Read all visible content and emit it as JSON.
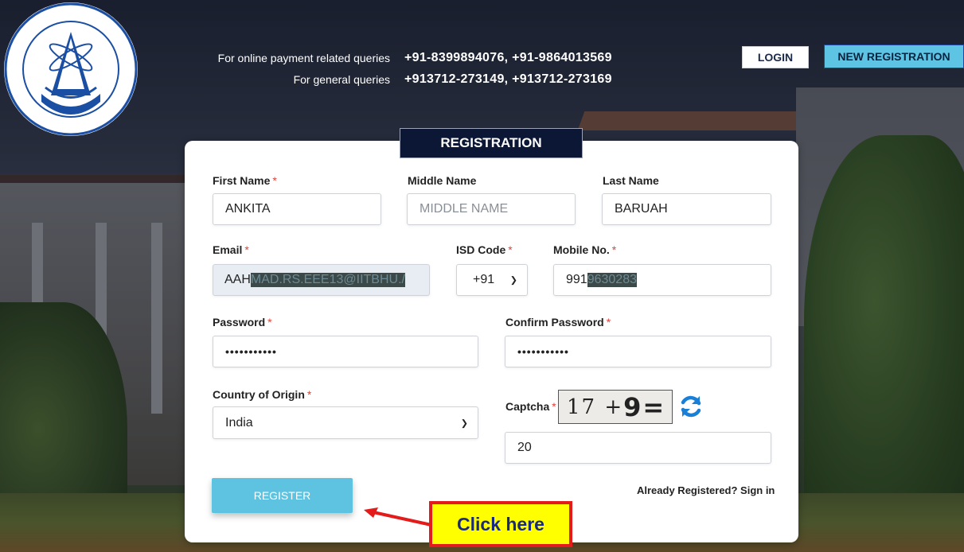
{
  "logo": {
    "alt": "Tezpur University"
  },
  "header": {
    "payment_label": "For online payment related queries",
    "payment_numbers": "+91-8399894076, +91-9864013569",
    "general_label": "For general queries",
    "general_numbers": "+913712-273149, +913712-273169",
    "login_button": "LOGIN",
    "new_registration_button": "NEW REGISTRATION"
  },
  "form": {
    "title": "REGISTRATION",
    "first_name": {
      "label": "First Name",
      "required": "*",
      "value": "ANKITA"
    },
    "middle_name": {
      "label": "Middle Name",
      "placeholder": "MIDDLE NAME"
    },
    "last_name": {
      "label": "Last Name",
      "value": "BARUAH"
    },
    "email": {
      "label": "Email",
      "required": "*",
      "value_visible": "AAH",
      "value_redacted": "MAD.RS.EEE13@IITBHU./"
    },
    "isd_code": {
      "label": "ISD Code",
      "required": "*",
      "value": "+91"
    },
    "mobile": {
      "label": "Mobile No.",
      "required": "*",
      "value_visible": "991",
      "value_redacted": "9630283"
    },
    "password": {
      "label": "Password",
      "required": "*",
      "value": "•••••••••••"
    },
    "confirm_password": {
      "label": "Confirm Password",
      "required": "*",
      "value": "•••••••••••"
    },
    "country": {
      "label": "Country of Origin",
      "required": "*",
      "value": "India"
    },
    "captcha": {
      "label": "Captcha",
      "required": "*",
      "challenge_part1": "17 + ",
      "challenge_bold": "9",
      "challenge_part2": " =",
      "answer": "20"
    },
    "register_button": "REGISTER",
    "signin_link": "Already Registered? Sign in"
  },
  "annotation": {
    "callout_text": "Click here"
  },
  "colors": {
    "accent": "#5ec3e0",
    "title_bg": "#0c1736",
    "required": "#e2413b",
    "callout_border": "#e31b1b",
    "callout_bg": "#ffff00"
  },
  "icons": {
    "refresh": "refresh-icon",
    "select_caret": "chevron-down-icon"
  }
}
